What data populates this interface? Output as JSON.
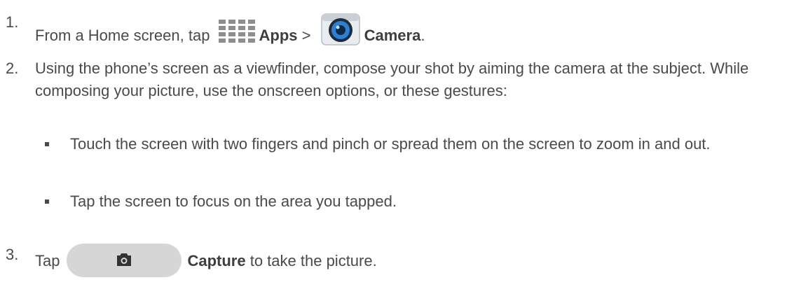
{
  "steps": [
    {
      "number": "1.",
      "text_before": "From a Home screen, tap ",
      "apps_label": "Apps",
      "separator": " > ",
      "camera_label": "Camera",
      "text_after": "."
    },
    {
      "number": "2.",
      "text": "Using the phone’s screen as a viewfinder, compose your shot by aiming the camera at the subject. While composing your picture, use the onscreen options, or these gestures:"
    },
    {
      "number": "3.",
      "text_before": "Tap",
      "capture_label": "Capture",
      "text_after": " to take the picture."
    }
  ],
  "bullets": [
    "Touch the screen with two fingers and pinch or spread them on the screen to zoom in and out.",
    "Tap the screen to focus on the area you tapped."
  ],
  "icons": {
    "apps": "apps-grid-icon",
    "camera": "camera-app-icon",
    "capture": "capture-button-camera-icon"
  },
  "colors": {
    "text": "#4a4a4a",
    "capture_button_bg": "#d6d6d6",
    "camera_icon_blue": "#2f7fd3"
  }
}
